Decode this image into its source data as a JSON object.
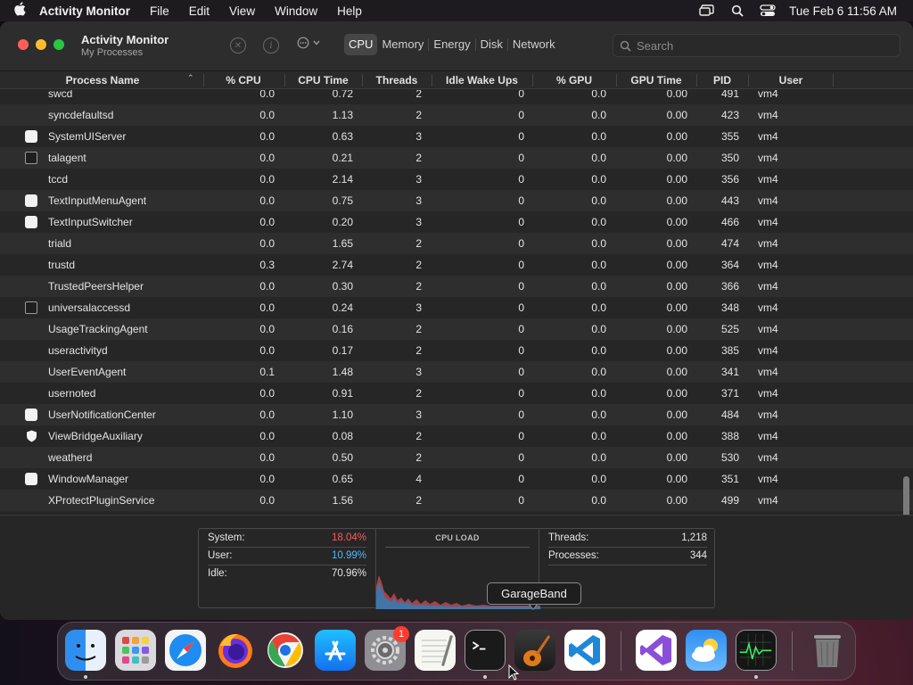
{
  "menubar": {
    "app_name": "Activity Monitor",
    "menus": [
      "File",
      "Edit",
      "View",
      "Window",
      "Help"
    ],
    "clock": "Tue Feb 6  11:56 AM",
    "status_icons": [
      "screen-mirroring-icon",
      "search-icon",
      "control-center-icon"
    ]
  },
  "window": {
    "title": "Activity Monitor",
    "subtitle": "My Processes",
    "tabs": [
      "CPU",
      "Memory",
      "Energy",
      "Disk",
      "Network"
    ],
    "active_tab": "CPU",
    "search": {
      "placeholder": "Search",
      "value": ""
    },
    "filter_icon": "ellipsis-circle-icon"
  },
  "table": {
    "columns": [
      "Process Name",
      "% CPU",
      "CPU Time",
      "Threads",
      "Idle Wake Ups",
      "% GPU",
      "GPU Time",
      "PID",
      "User"
    ],
    "sorted_by": "Process Name",
    "rows": [
      {
        "icon": "",
        "name": "swcd",
        "cpu": "0.0",
        "cpu_time": "0.72",
        "threads": "2",
        "idle": "0",
        "gpu": "0.0",
        "gpu_time": "0.00",
        "pid": "491",
        "user": "vm4"
      },
      {
        "icon": "",
        "name": "syncdefaultsd",
        "cpu": "0.0",
        "cpu_time": "1.13",
        "threads": "2",
        "idle": "0",
        "gpu": "0.0",
        "gpu_time": "0.00",
        "pid": "423",
        "user": "vm4"
      },
      {
        "icon": "white",
        "name": "SystemUIServer",
        "cpu": "0.0",
        "cpu_time": "0.63",
        "threads": "3",
        "idle": "0",
        "gpu": "0.0",
        "gpu_time": "0.00",
        "pid": "355",
        "user": "vm4"
      },
      {
        "icon": "terminal",
        "name": "talagent",
        "cpu": "0.0",
        "cpu_time": "0.21",
        "threads": "2",
        "idle": "0",
        "gpu": "0.0",
        "gpu_time": "0.00",
        "pid": "350",
        "user": "vm4"
      },
      {
        "icon": "",
        "name": "tccd",
        "cpu": "0.0",
        "cpu_time": "2.14",
        "threads": "3",
        "idle": "0",
        "gpu": "0.0",
        "gpu_time": "0.00",
        "pid": "356",
        "user": "vm4"
      },
      {
        "icon": "white",
        "name": "TextInputMenuAgent",
        "cpu": "0.0",
        "cpu_time": "0.75",
        "threads": "3",
        "idle": "0",
        "gpu": "0.0",
        "gpu_time": "0.00",
        "pid": "443",
        "user": "vm4"
      },
      {
        "icon": "white",
        "name": "TextInputSwitcher",
        "cpu": "0.0",
        "cpu_time": "0.20",
        "threads": "3",
        "idle": "0",
        "gpu": "0.0",
        "gpu_time": "0.00",
        "pid": "466",
        "user": "vm4"
      },
      {
        "icon": "",
        "name": "triald",
        "cpu": "0.0",
        "cpu_time": "1.65",
        "threads": "2",
        "idle": "0",
        "gpu": "0.0",
        "gpu_time": "0.00",
        "pid": "474",
        "user": "vm4"
      },
      {
        "icon": "",
        "name": "trustd",
        "cpu": "0.3",
        "cpu_time": "2.74",
        "threads": "2",
        "idle": "0",
        "gpu": "0.0",
        "gpu_time": "0.00",
        "pid": "364",
        "user": "vm4"
      },
      {
        "icon": "",
        "name": "TrustedPeersHelper",
        "cpu": "0.0",
        "cpu_time": "0.30",
        "threads": "2",
        "idle": "0",
        "gpu": "0.0",
        "gpu_time": "0.00",
        "pid": "366",
        "user": "vm4"
      },
      {
        "icon": "terminal",
        "name": "universalaccessd",
        "cpu": "0.0",
        "cpu_time": "0.24",
        "threads": "3",
        "idle": "0",
        "gpu": "0.0",
        "gpu_time": "0.00",
        "pid": "348",
        "user": "vm4"
      },
      {
        "icon": "",
        "name": "UsageTrackingAgent",
        "cpu": "0.0",
        "cpu_time": "0.16",
        "threads": "2",
        "idle": "0",
        "gpu": "0.0",
        "gpu_time": "0.00",
        "pid": "525",
        "user": "vm4"
      },
      {
        "icon": "",
        "name": "useractivityd",
        "cpu": "0.0",
        "cpu_time": "0.17",
        "threads": "2",
        "idle": "0",
        "gpu": "0.0",
        "gpu_time": "0.00",
        "pid": "385",
        "user": "vm4"
      },
      {
        "icon": "",
        "name": "UserEventAgent",
        "cpu": "0.1",
        "cpu_time": "1.48",
        "threads": "3",
        "idle": "0",
        "gpu": "0.0",
        "gpu_time": "0.00",
        "pid": "341",
        "user": "vm4"
      },
      {
        "icon": "",
        "name": "usernoted",
        "cpu": "0.0",
        "cpu_time": "0.91",
        "threads": "2",
        "idle": "0",
        "gpu": "0.0",
        "gpu_time": "0.00",
        "pid": "371",
        "user": "vm4"
      },
      {
        "icon": "white",
        "name": "UserNotificationCenter",
        "cpu": "0.0",
        "cpu_time": "1.10",
        "threads": "3",
        "idle": "0",
        "gpu": "0.0",
        "gpu_time": "0.00",
        "pid": "484",
        "user": "vm4"
      },
      {
        "icon": "shield",
        "name": "ViewBridgeAuxiliary",
        "cpu": "0.0",
        "cpu_time": "0.08",
        "threads": "2",
        "idle": "0",
        "gpu": "0.0",
        "gpu_time": "0.00",
        "pid": "388",
        "user": "vm4"
      },
      {
        "icon": "",
        "name": "weatherd",
        "cpu": "0.0",
        "cpu_time": "0.50",
        "threads": "2",
        "idle": "0",
        "gpu": "0.0",
        "gpu_time": "0.00",
        "pid": "530",
        "user": "vm4"
      },
      {
        "icon": "white",
        "name": "WindowManager",
        "cpu": "0.0",
        "cpu_time": "0.65",
        "threads": "4",
        "idle": "0",
        "gpu": "0.0",
        "gpu_time": "0.00",
        "pid": "351",
        "user": "vm4"
      },
      {
        "icon": "",
        "name": "XProtectPluginService",
        "cpu": "0.0",
        "cpu_time": "1.56",
        "threads": "2",
        "idle": "0",
        "gpu": "0.0",
        "gpu_time": "0.00",
        "pid": "499",
        "user": "vm4"
      }
    ]
  },
  "stats": {
    "system_label": "System:",
    "system_value": "18.04%",
    "user_label": "User:",
    "user_value": "10.99%",
    "idle_label": "Idle:",
    "idle_value": "70.96%",
    "cpu_load_title": "CPU LOAD",
    "threads_label": "Threads:",
    "threads_value": "1,218",
    "processes_label": "Processes:",
    "processes_value": "344",
    "system_color": "#ff5a5a",
    "user_color": "#4fb8ff"
  },
  "tooltip": {
    "text": "GarageBand"
  },
  "dock": {
    "apps": [
      "finder-icon",
      "launchpad-icon",
      "safari-icon",
      "firefox-icon",
      "chrome-icon",
      "app-store-icon",
      "system-settings-icon",
      "textedit-icon",
      "terminal-icon",
      "garageband-icon",
      "vscode-icon",
      "visual-studio-icon",
      "weather-icon",
      "activity-monitor-icon",
      "trash-icon"
    ],
    "settings_badge": "1"
  }
}
